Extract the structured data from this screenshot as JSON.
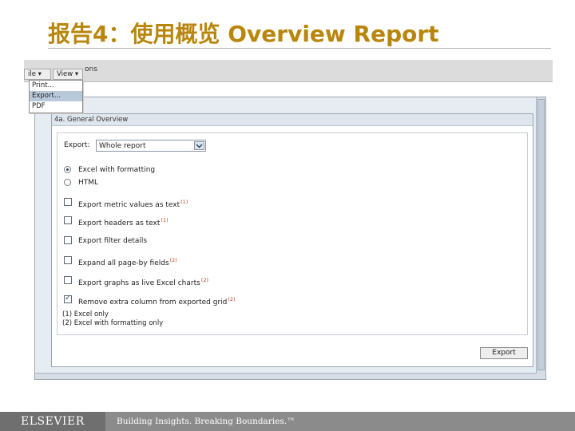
{
  "slide": {
    "title": "报告4：使用概览 Overview Report"
  },
  "toolbar": {
    "partial_label": "ons",
    "file_menu": "ile ▾",
    "view_menu": "View ▾"
  },
  "file_dropdown": {
    "items": [
      {
        "label": "Print...",
        "selected": false
      },
      {
        "label": "Export...",
        "selected": true
      },
      {
        "label": "PDF",
        "selected": false
      }
    ]
  },
  "panel": {
    "header": "4a. General Overview",
    "export_label": "Export:",
    "export_select_value": "Whole report",
    "format_options": [
      {
        "label": "Excel with formatting",
        "checked": true
      },
      {
        "label": "HTML",
        "checked": false
      }
    ],
    "check_options": [
      {
        "label": "Export metric values as text",
        "note": "(1)",
        "checked": false
      },
      {
        "label": "Export headers as text",
        "note": "(1)",
        "checked": false
      },
      {
        "label": "Export filter details",
        "note": "",
        "checked": false
      },
      {
        "label": "Expand all page-by fields",
        "note": "(2)",
        "checked": false
      },
      {
        "label": "Export graphs as live Excel charts",
        "note": "(2)",
        "checked": false
      },
      {
        "label": "Remove extra column from exported grid",
        "note": "(2)",
        "checked": true
      }
    ],
    "footnotes": [
      "(1) Excel only",
      "(2) Excel with formatting only"
    ],
    "export_button": "Export"
  },
  "footer": {
    "logo": "ELSEVIER",
    "tagline": "Building Insights. Breaking Boundaries.™"
  }
}
